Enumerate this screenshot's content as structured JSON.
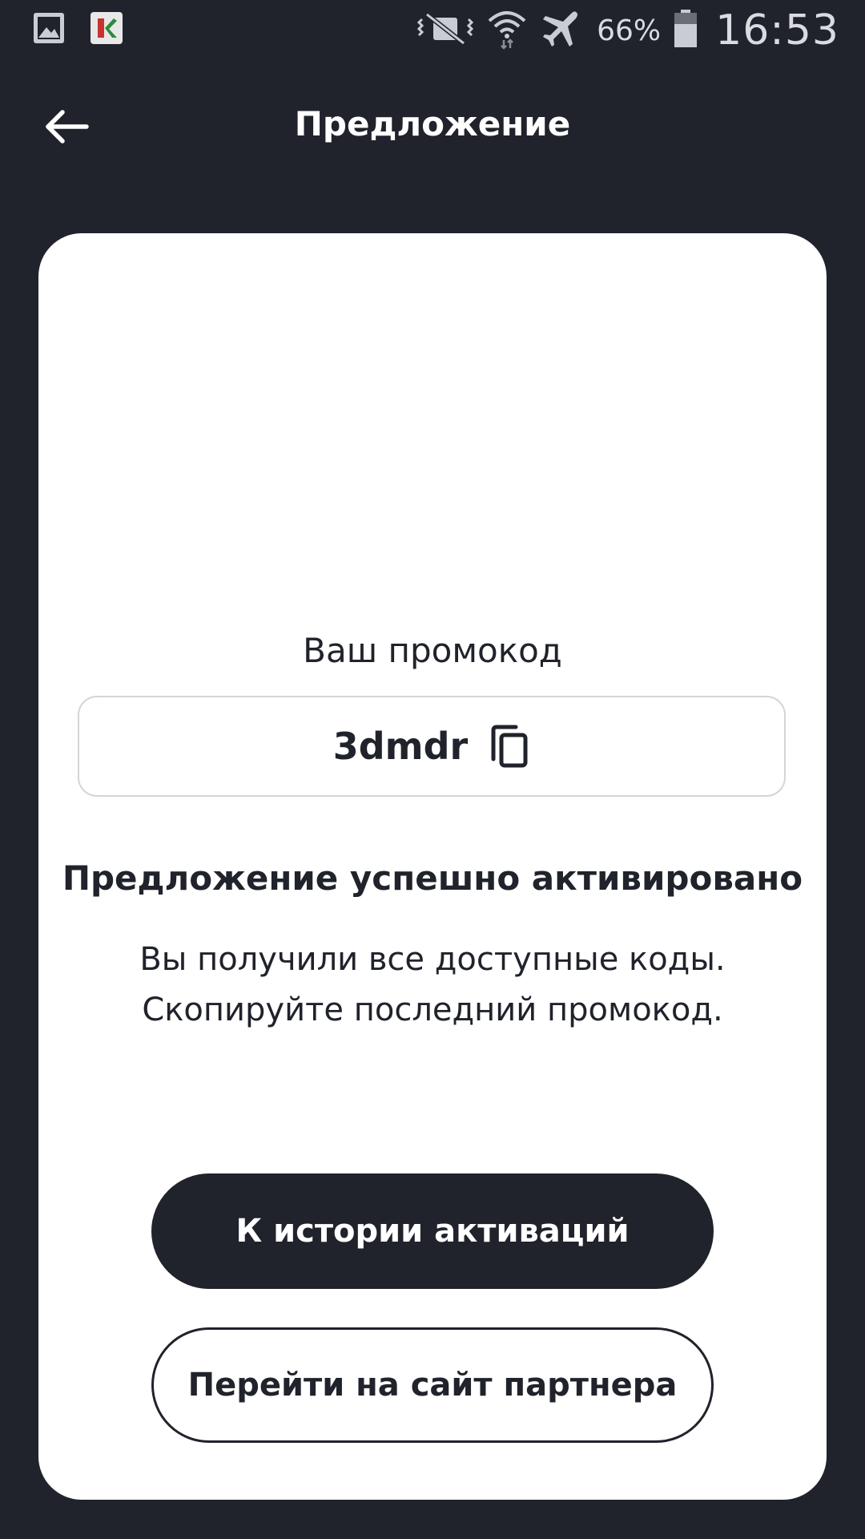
{
  "status_bar": {
    "left_icons": [
      "gallery-notification-icon",
      "app-notification-icon"
    ],
    "right_icons": [
      "vibrate-icon",
      "wifi-icon",
      "airplane-icon",
      "battery-icon"
    ],
    "battery_percent": "66%",
    "time": "16:53"
  },
  "header": {
    "title": "Предложение",
    "back_icon": "arrow-left-icon"
  },
  "card": {
    "promo_label": "Ваш промокод",
    "promo_code": "3dmdr",
    "copy_icon": "copy-icon",
    "success_title": "Предложение успешно активировано",
    "description_line_1": "Вы получили все доступные коды.",
    "description_line_2": "Скопируйте последний промокод.",
    "primary_button": "К истории активаций",
    "secondary_button": "Перейти на сайт партнера"
  },
  "colors": {
    "background": "#20232b",
    "card": "#ffffff",
    "text": "#20232b",
    "border": "#d3d5da"
  }
}
